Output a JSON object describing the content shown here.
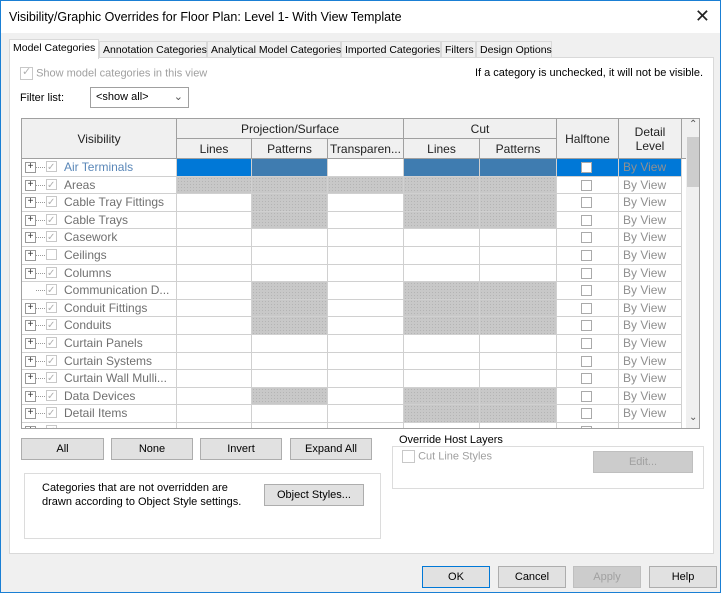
{
  "window": {
    "title": "Visibility/Graphic Overrides for Floor Plan: Level 1- With View Template",
    "close_icon": "close-icon"
  },
  "tabs": [
    {
      "label": "Model Categories",
      "active": true
    },
    {
      "label": "Annotation Categories"
    },
    {
      "label": "Analytical Model Categories"
    },
    {
      "label": "Imported Categories"
    },
    {
      "label": "Filters"
    },
    {
      "label": "Design Options"
    }
  ],
  "show_model": {
    "label": "Show model categories in this view",
    "checked": true,
    "disabled": true
  },
  "hint": "If a category is unchecked, it will not be visible.",
  "filter": {
    "label": "Filter list:",
    "value": "<show all>"
  },
  "grid": {
    "headers": {
      "visibility": "Visibility",
      "projection": "Projection/Surface",
      "cut": "Cut",
      "halftone": "Halftone",
      "detail_level": "Detail Level",
      "proj_lines": "Lines",
      "proj_patterns": "Patterns",
      "transparency": "Transparen...",
      "cut_lines": "Lines",
      "cut_patterns": "Patterns"
    },
    "rows": [
      {
        "name": "Air Terminals",
        "checked": true,
        "expand": true,
        "selected": true,
        "grey": [],
        "detail": "By View"
      },
      {
        "name": "Areas",
        "checked": true,
        "expand": true,
        "grey": [
          0,
          1,
          2,
          3,
          4
        ],
        "detail": "By View"
      },
      {
        "name": "Cable Tray Fittings",
        "checked": true,
        "expand": true,
        "grey": [
          1,
          3,
          4
        ],
        "detail": "By View"
      },
      {
        "name": "Cable Trays",
        "checked": true,
        "expand": true,
        "grey": [
          1,
          3,
          4
        ],
        "detail": "By View"
      },
      {
        "name": "Casework",
        "checked": true,
        "expand": true,
        "grey": [],
        "detail": "By View"
      },
      {
        "name": "Ceilings",
        "checked": false,
        "expand": true,
        "grey": [],
        "detail": "By View"
      },
      {
        "name": "Columns",
        "checked": true,
        "expand": true,
        "grey": [],
        "detail": "By View"
      },
      {
        "name": "Communication D...",
        "checked": true,
        "expand": false,
        "grey": [
          1,
          3,
          4
        ],
        "detail": "By View"
      },
      {
        "name": "Conduit Fittings",
        "checked": true,
        "expand": true,
        "grey": [
          1,
          3,
          4
        ],
        "detail": "By View"
      },
      {
        "name": "Conduits",
        "checked": true,
        "expand": true,
        "grey": [
          1,
          3,
          4
        ],
        "detail": "By View"
      },
      {
        "name": "Curtain Panels",
        "checked": true,
        "expand": true,
        "grey": [],
        "detail": "By View"
      },
      {
        "name": "Curtain Systems",
        "checked": true,
        "expand": true,
        "grey": [],
        "detail": "By View"
      },
      {
        "name": "Curtain Wall Mulli...",
        "checked": true,
        "expand": true,
        "grey": [],
        "detail": "By View"
      },
      {
        "name": "Data Devices",
        "checked": true,
        "expand": true,
        "grey": [
          1,
          3,
          4
        ],
        "detail": "By View"
      },
      {
        "name": "Detail Items",
        "checked": true,
        "expand": true,
        "grey": [
          3,
          4
        ],
        "detail": "By View"
      },
      {
        "name": "",
        "checked": true,
        "expand": true,
        "grey": [],
        "detail": ""
      }
    ]
  },
  "buttons": {
    "all": "All",
    "none": "None",
    "invert": "Invert",
    "expand_all": "Expand All",
    "object_styles": "Object Styles...",
    "edit": "Edit...",
    "ok": "OK",
    "cancel": "Cancel",
    "apply": "Apply",
    "help": "Help"
  },
  "note": "Categories that are not overridden are drawn according to Object Style settings.",
  "host_layers": {
    "title": "Override Host Layers",
    "cut_line_styles": "Cut Line Styles",
    "checked": false
  },
  "colors": {
    "selection": "#0078d7",
    "selection_dark": "#3f7cb0",
    "disabled_cell": "#c8c8c8"
  }
}
